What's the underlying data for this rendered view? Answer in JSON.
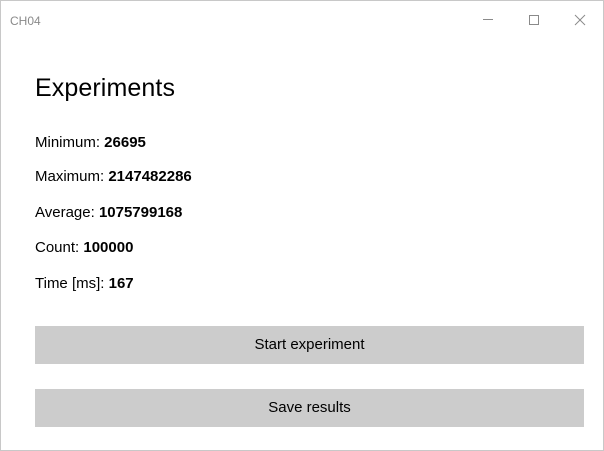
{
  "window": {
    "title": "CH04",
    "controls": {
      "minimize_icon": "minimize-icon",
      "maximize_icon": "maximize-icon",
      "close_icon": "close-icon"
    }
  },
  "main": {
    "heading": "Experiments",
    "stats": [
      {
        "label": "Minimum: ",
        "value": "26695"
      },
      {
        "label": "Maximum: ",
        "value": "2147482286"
      },
      {
        "label": "Average: ",
        "value": "1075799168"
      },
      {
        "label": "Count: ",
        "value": "100000"
      },
      {
        "label": "Time [ms]: ",
        "value": "167"
      }
    ],
    "buttons": {
      "start_label": "Start experiment",
      "save_label": "Save results"
    }
  },
  "colors": {
    "button_background": "#cccccc",
    "title_text": "#8a8a8a",
    "window_border": "#c8c8c8"
  }
}
